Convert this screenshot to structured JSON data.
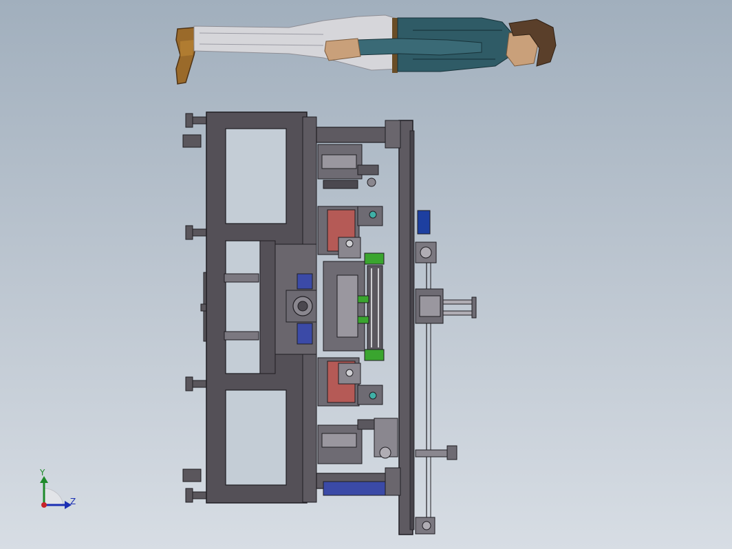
{
  "viewport": {
    "kind": "3d-cad-model-view",
    "background": {
      "top": "#a1afbd",
      "bottom": "#d7dde4"
    },
    "model": {
      "human_reference_figure": {
        "shown": true,
        "shirt_color": "#2f5b66",
        "pants_color": "#d5d5d8",
        "hair_color": "#5a3f2a"
      },
      "machine_frame": {
        "frame_color": "#545057",
        "accent_colors": [
          "#3aa52f",
          "#1d3fa0",
          "#3fb0a6",
          "#b55a56"
        ]
      }
    },
    "triad": {
      "y_label": "Y",
      "z_label": "Z",
      "y_color": "#1e8a2a",
      "z_color": "#1b2fb3",
      "origin_color": "#c8232a"
    }
  }
}
